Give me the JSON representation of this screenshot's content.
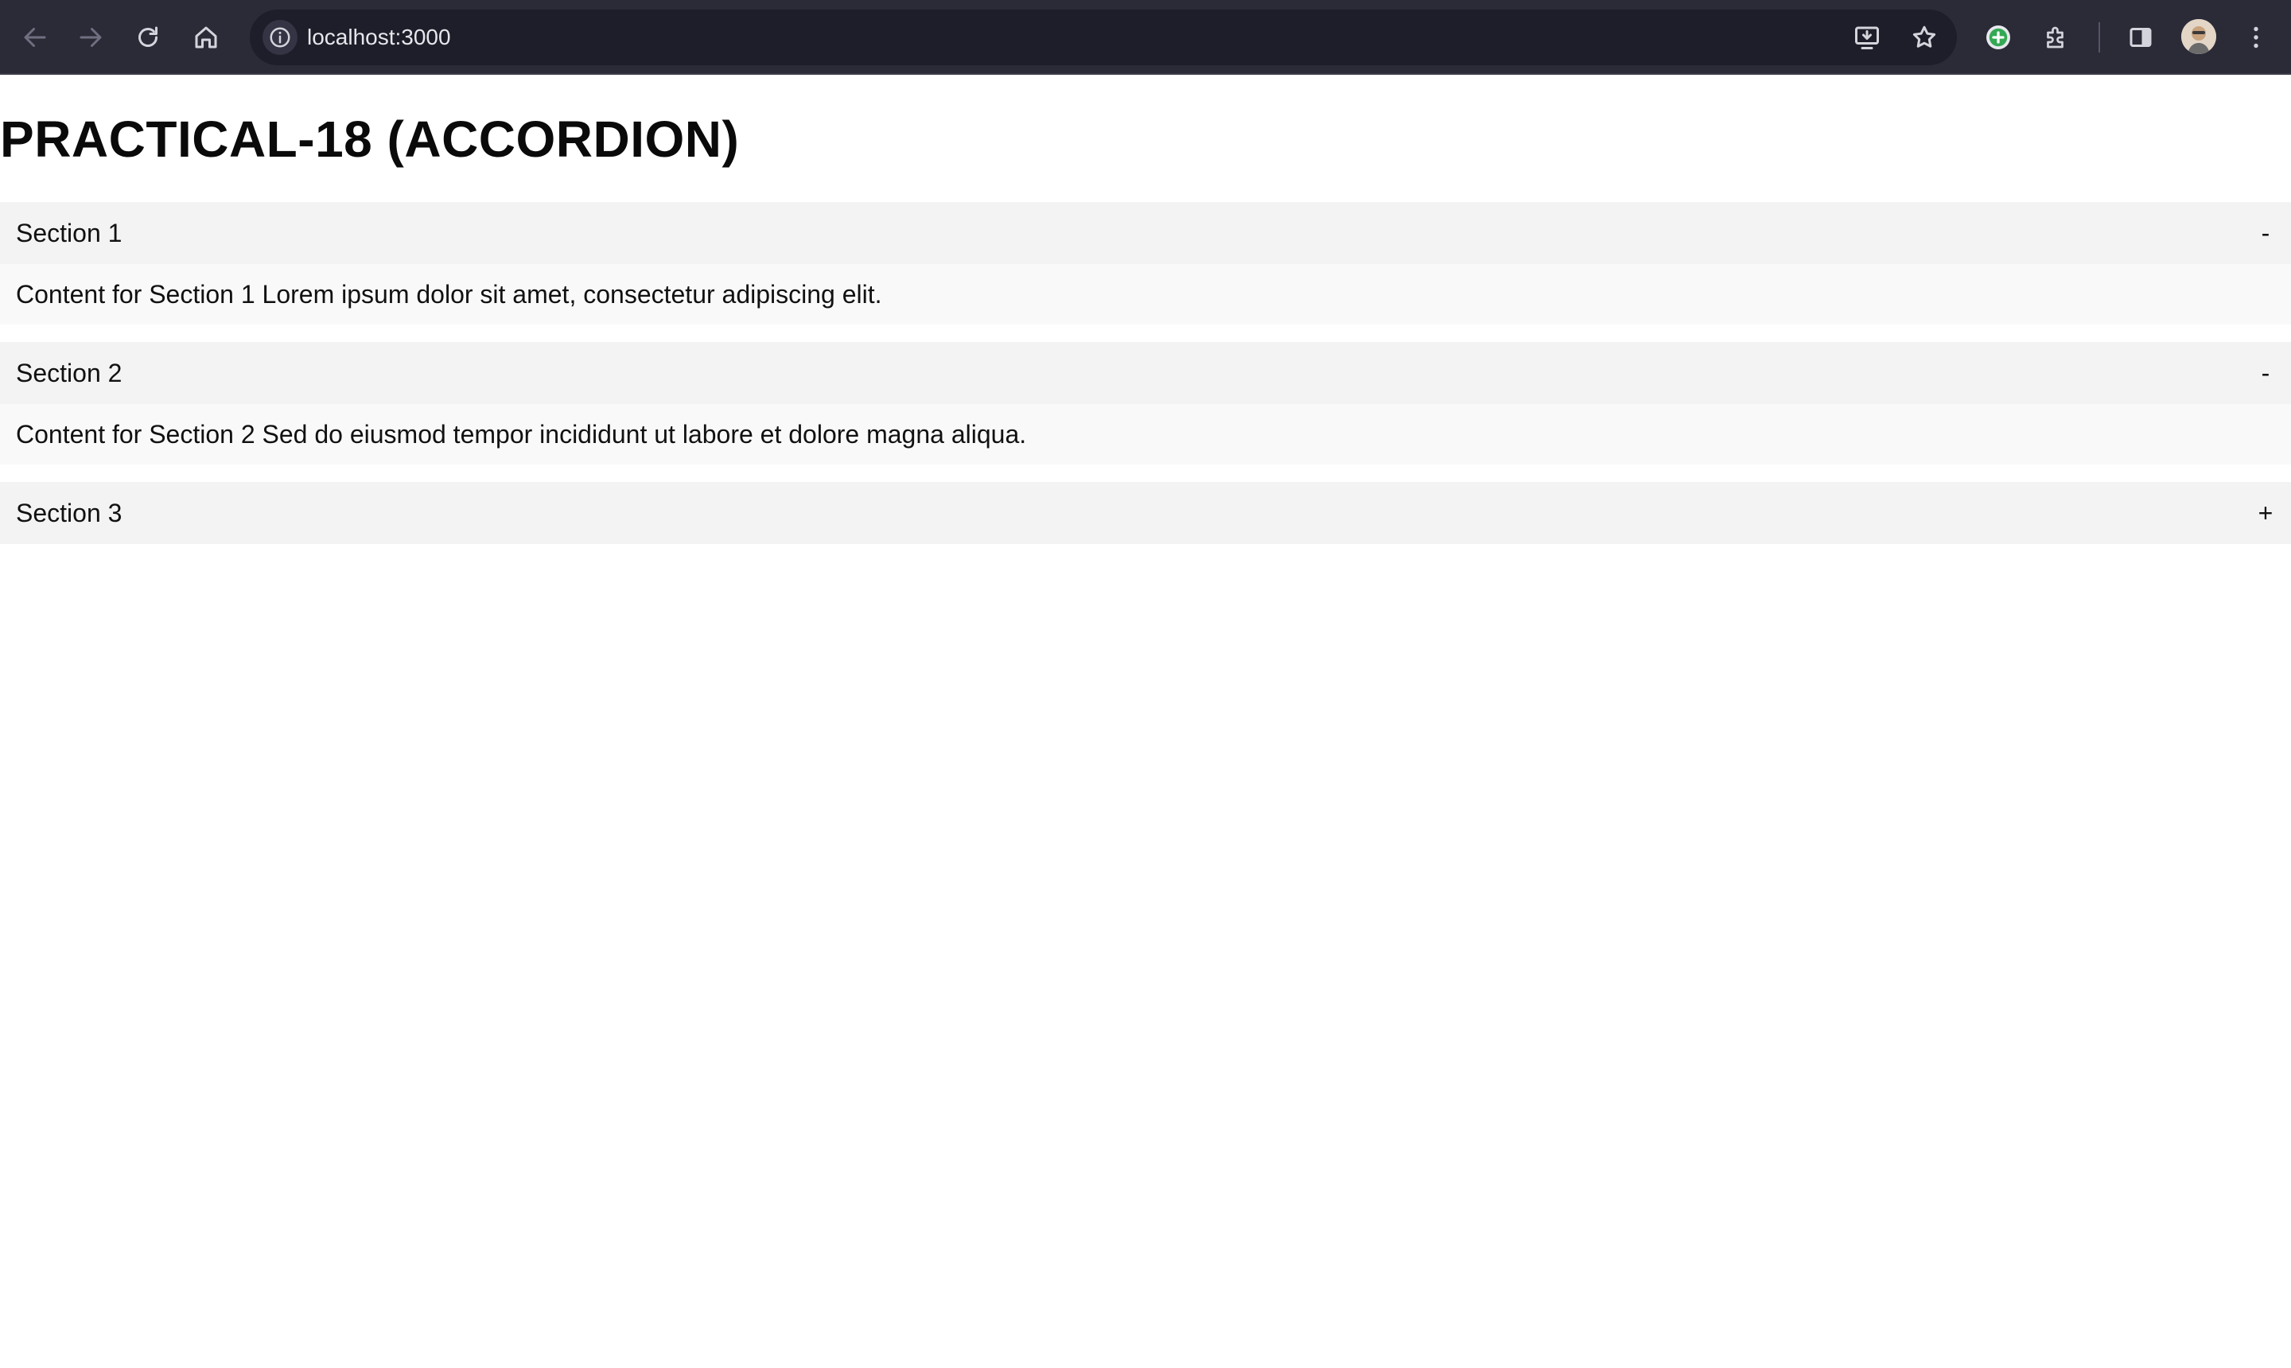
{
  "browser": {
    "url": "localhost:3000",
    "icons": {
      "back": "back-arrow-icon",
      "forward": "forward-arrow-icon",
      "reload": "reload-icon",
      "home": "home-icon",
      "info": "info-icon",
      "install": "install-app-icon",
      "bookmark": "star-icon",
      "extension_add": "plus-circle-icon",
      "extensions": "puzzle-icon",
      "side_panel": "side-panel-icon",
      "profile": "avatar",
      "menu": "kebab-menu-icon"
    }
  },
  "page": {
    "title": "PRACTICAL-18 (ACCORDION)",
    "sections": [
      {
        "title": "Section 1",
        "toggle": "-",
        "expanded": true,
        "content": "Content for Section 1 Lorem ipsum dolor sit amet, consectetur adipiscing elit."
      },
      {
        "title": "Section 2",
        "toggle": "-",
        "expanded": true,
        "content": "Content for Section 2 Sed do eiusmod tempor incididunt ut labore et dolore magna aliqua."
      },
      {
        "title": "Section 3",
        "toggle": "+",
        "expanded": false
      }
    ]
  },
  "colors": {
    "toolbar_bg": "#2b2b38",
    "header_bg": "#f3f3f3",
    "content_bg": "#f9f9f9",
    "accent_green": "#34a853"
  }
}
